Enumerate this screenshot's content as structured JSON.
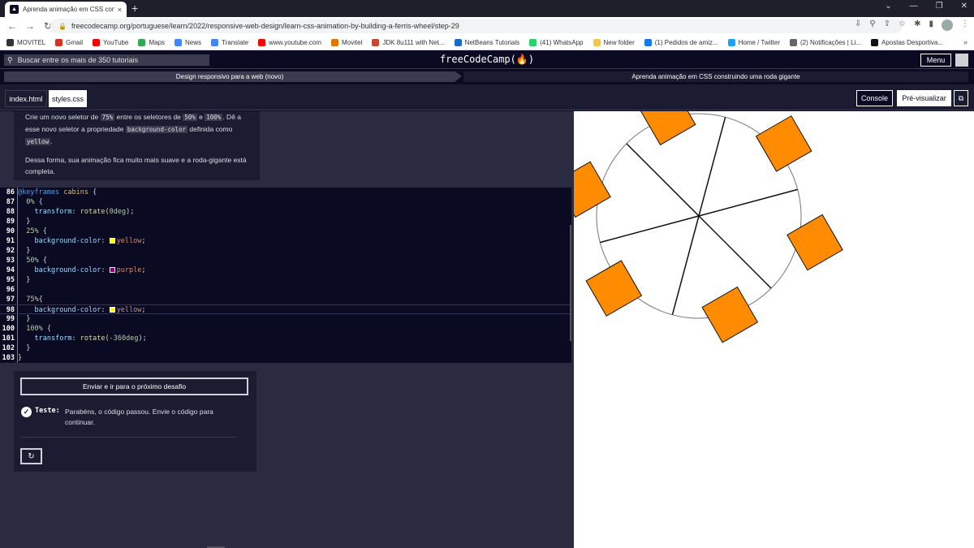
{
  "browser": {
    "tab_title": "Aprenda animação em CSS cons",
    "tab_close": "×",
    "new_tab": "+",
    "url": "freecodecamp.org/portuguese/learn/2022/responsive-web-design/learn-css-animation-by-building-a-ferris-wheel/step-29",
    "bookmarks": [
      {
        "label": "MOVITEL",
        "color": "#333333"
      },
      {
        "label": "Gmail",
        "color": "#d93025"
      },
      {
        "label": "YouTube",
        "color": "#ff0000"
      },
      {
        "label": "Maps",
        "color": "#34a853"
      },
      {
        "label": "News",
        "color": "#4285f4"
      },
      {
        "label": "Translate",
        "color": "#4285f4"
      },
      {
        "label": "www.youtube.com",
        "color": "#ff0000"
      },
      {
        "label": "Movitel",
        "color": "#e37400"
      },
      {
        "label": "JDK 8u111 with Net...",
        "color": "#c74634"
      },
      {
        "label": "NetBeans Tutorials",
        "color": "#1b6ac9"
      },
      {
        "label": "(41) WhatsApp",
        "color": "#25d366"
      },
      {
        "label": "New folder",
        "color": "#f6c744"
      },
      {
        "label": "(1) Pedidos de amiz...",
        "color": "#1877f2"
      },
      {
        "label": "Home / Twitter",
        "color": "#1da1f2"
      },
      {
        "label": "(2) Notificações | Li...",
        "color": "#666666"
      },
      {
        "label": "Apostas Desportiva...",
        "color": "#111111"
      }
    ]
  },
  "fcc_nav": {
    "search_placeholder": "Buscar entre os mais de 350 tutoriais",
    "logo": "freeCodeCamp(🔥)",
    "menu_label": "Menu"
  },
  "breadcrumb": {
    "course": "Design responsivo para a web (novo)",
    "project": "Aprenda animação em CSS construindo uma roda gigante"
  },
  "editor_tabs": {
    "index": "index.html",
    "styles": "styles.css",
    "console": "Console",
    "preview": "Pré-visualizar"
  },
  "instructions": {
    "p1_a": "Crie um novo seletor de ",
    "p1_c1": "75%",
    "p1_b": " entre os seletores de ",
    "p1_c2": "50%",
    "p1_c": " e ",
    "p1_c3": "100%",
    "p1_d": ". Dê a esse novo seletor a propriedade ",
    "p1_c4": "background-color",
    "p1_e": " definida como ",
    "p1_c5": "yellow",
    "p1_f": ".",
    "p2": "Dessa forma, sua animação fica muito mais suave e a roda-gigante está completa."
  },
  "code_lines": [
    {
      "n": "86",
      "segs": [
        [
          "kw",
          "@keyframes"
        ],
        [
          "t",
          " "
        ],
        [
          "sel",
          "cabins"
        ],
        [
          "t",
          " {"
        ]
      ]
    },
    {
      "n": "87",
      "segs": [
        [
          "t",
          "  "
        ],
        [
          "num",
          "0%"
        ],
        [
          "t",
          " {"
        ]
      ]
    },
    {
      "n": "88",
      "segs": [
        [
          "t",
          "    "
        ],
        [
          "prop",
          "transform"
        ],
        [
          "t",
          ": "
        ],
        [
          "fn",
          "rotate("
        ],
        [
          "num",
          "0deg"
        ],
        [
          "fn",
          ")"
        ],
        [
          "t",
          ";"
        ]
      ]
    },
    {
      "n": "89",
      "segs": [
        [
          "t",
          "  }"
        ]
      ]
    },
    {
      "n": "90",
      "segs": [
        [
          "t",
          "  "
        ],
        [
          "num",
          "25%"
        ],
        [
          "t",
          " {"
        ]
      ]
    },
    {
      "n": "91",
      "segs": [
        [
          "t",
          "    "
        ],
        [
          "prop",
          "background-color"
        ],
        [
          "t",
          ": "
        ],
        [
          "sw",
          "#ffff00"
        ],
        [
          "val",
          "yellow"
        ],
        [
          "t",
          ";"
        ]
      ]
    },
    {
      "n": "92",
      "segs": [
        [
          "t",
          "  }"
        ]
      ]
    },
    {
      "n": "93",
      "segs": [
        [
          "t",
          "  "
        ],
        [
          "num",
          "50%"
        ],
        [
          "t",
          " {"
        ]
      ]
    },
    {
      "n": "94",
      "segs": [
        [
          "t",
          "    "
        ],
        [
          "prop",
          "background-color"
        ],
        [
          "t",
          ": "
        ],
        [
          "sw",
          "#800080"
        ],
        [
          "val",
          "purple"
        ],
        [
          "t",
          ";"
        ]
      ]
    },
    {
      "n": "95",
      "segs": [
        [
          "t",
          "  }"
        ]
      ]
    },
    {
      "n": "96",
      "segs": [
        [
          "t",
          ""
        ]
      ]
    },
    {
      "n": "97",
      "segs": [
        [
          "t",
          "  "
        ],
        [
          "num",
          "75%"
        ],
        [
          "t",
          "{"
        ]
      ]
    },
    {
      "n": "98",
      "segs": [
        [
          "t",
          "    "
        ],
        [
          "prop",
          "background-color"
        ],
        [
          "t",
          ": "
        ],
        [
          "sw",
          "#ffff00"
        ],
        [
          "val",
          "yellow"
        ],
        [
          "t",
          ";"
        ]
      ],
      "active": true
    },
    {
      "n": "99",
      "segs": [
        [
          "t",
          "  }"
        ]
      ]
    },
    {
      "n": "100",
      "segs": [
        [
          "t",
          "  "
        ],
        [
          "num",
          "100%"
        ],
        [
          "t",
          " {"
        ]
      ]
    },
    {
      "n": "101",
      "segs": [
        [
          "t",
          "    "
        ],
        [
          "prop",
          "transform"
        ],
        [
          "t",
          ": "
        ],
        [
          "fn",
          "rotate("
        ],
        [
          "num",
          "-360deg"
        ],
        [
          "fn",
          ")"
        ],
        [
          "t",
          ";"
        ]
      ]
    },
    {
      "n": "102",
      "segs": [
        [
          "t",
          "  }"
        ]
      ]
    },
    {
      "n": "103",
      "segs": [
        [
          "t",
          "}"
        ]
      ]
    }
  ],
  "test_panel": {
    "submit_label": "Enviar e ir para o próximo desafio",
    "test_label": "Teste:",
    "test_message": "Parabéns, o código passou. Envie o código para continuar.",
    "reset_icon": "↻"
  },
  "preview": {
    "cabin_color": "#ff8c00",
    "cabin_count": 6,
    "spoke_count": 6
  }
}
